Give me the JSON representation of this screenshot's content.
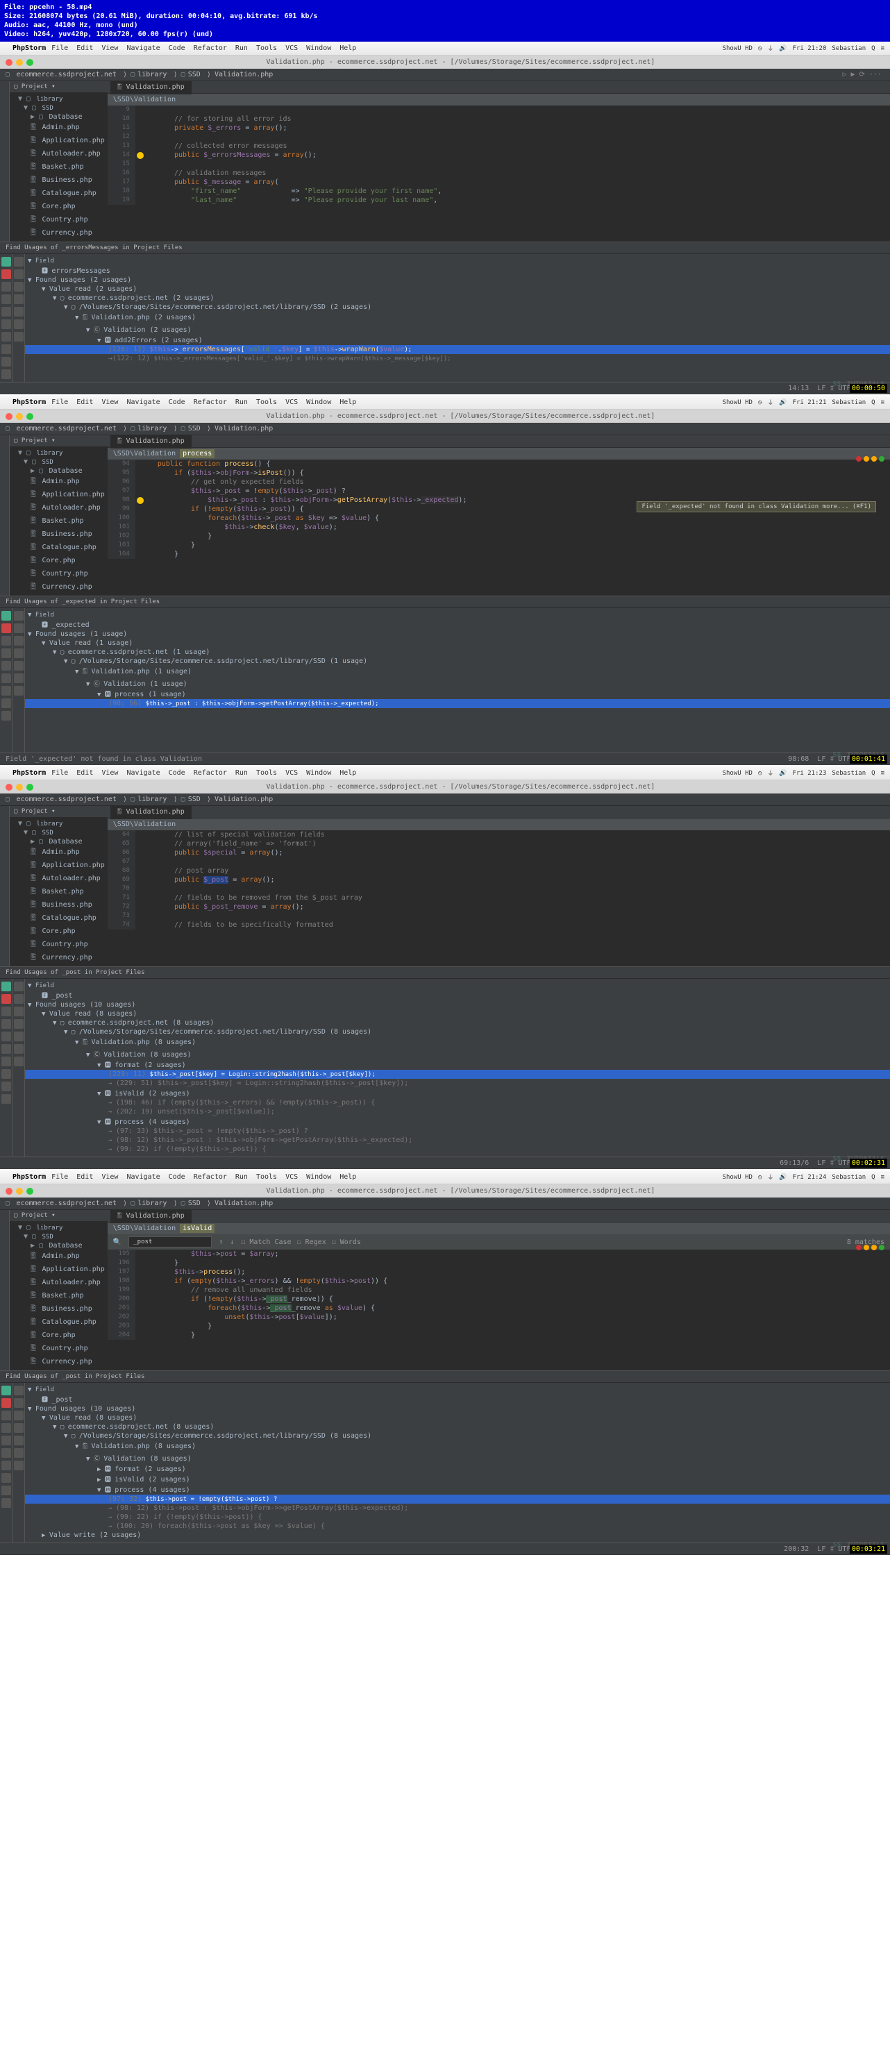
{
  "header": {
    "file": "File: ppcehn - 58.mp4",
    "size": "Size: 21608074 bytes (20.61 MiB), duration: 00:04:10, avg.bitrate: 691 kb/s",
    "audio": "Audio: aac, 44100 Hz, mono (und)",
    "video": "Video: h264, yuv420p, 1280x720, 60.00 fps(r) (und)"
  },
  "menus": [
    "File",
    "Edit",
    "View",
    "Navigate",
    "Code",
    "Refactor",
    "Run",
    "Tools",
    "VCS",
    "Window",
    "Help"
  ],
  "appname": "PhpStorm",
  "project_files": [
    "Database",
    "Admin.php",
    "Application.php",
    "Autoloader.php",
    "Basket.php",
    "Business.php",
    "Catalogue.php",
    "Core.php",
    "Country.php",
    "Currency.php"
  ],
  "breadcrumb": [
    "ecommerce.ssdproject.net",
    "library",
    "SSD",
    "Validation.php"
  ],
  "tab_name": "Validation.php",
  "shot1": {
    "time": "Fri 21:20",
    "user": "Sebastian",
    "title": "Validation.php - ecommerce.ssdproject.net - [/Volumes/Storage/Sites/ecommerce.ssdproject.net]",
    "namespace": "\\SSD\\Validation",
    "lines": [
      {
        "n": "9",
        "t": ""
      },
      {
        "n": "10",
        "t": "        // for storing all error ids"
      },
      {
        "n": "11",
        "t": "        private $_errors = array();"
      },
      {
        "n": "12",
        "t": ""
      },
      {
        "n": "13",
        "t": "        // collected error messages"
      },
      {
        "n": "14",
        "t": "        public $_errorsMessages = array();"
      },
      {
        "n": "15",
        "t": ""
      },
      {
        "n": "16",
        "t": "        // validation messages"
      },
      {
        "n": "17",
        "t": "        public $_message = array("
      },
      {
        "n": "18",
        "t": "            \"first_name\"            => \"Please provide your first name\","
      },
      {
        "n": "19",
        "t": "            \"last_name\"             => \"Please provide your last name\","
      }
    ],
    "find_title": "Find Usages of _errorsMessages in Project Files",
    "field": "errorsMessages",
    "found": "Found usages (2 usages)",
    "vr": "Value read (2 usages)",
    "proj": "ecommerce.ssdproject.net (2 usages)",
    "path": "/Volumes/Storage/Sites/ecommerce.ssdproject.net/library/SSD (2 usages)",
    "file": "Validation.php (2 usages)",
    "cls": "Validation (2 usages)",
    "method": "add2Errors (2 usages)",
    "u1": "(120: 12) $this->_errorsMessages['valid_'.$key] = $this->wrapWarn($value);",
    "u2": "(122: 12) $this->_errorsMessages['valid_'.$key] = $this->wrapWarn($this->_message[$key]);",
    "status_pos": "14:13",
    "status_lf": "LF ‡ UTF-8 ‡",
    "ts": "00:00:50"
  },
  "shot2": {
    "time": "Fri 21:21",
    "title": "Validation.php - ecommerce.ssdproject.net - [/Volumes/Storage/Sites/ecommerce.ssdproject.net]",
    "namespace": "\\SSD\\Validation",
    "method": "process",
    "lines": [
      {
        "n": "94",
        "t": "    public function process() {"
      },
      {
        "n": "95",
        "t": "        if ($this->objForm->isPost()) {"
      },
      {
        "n": "96",
        "t": "            // get only expected fields"
      },
      {
        "n": "97",
        "t": "            $this->_post = !empty($this->_post) ?"
      },
      {
        "n": "98",
        "t": "                $this->_post : $this->objForm->getPostArray($this->_expected);"
      },
      {
        "n": "99",
        "t": "            if (!empty($this->_post)) {"
      },
      {
        "n": "100",
        "t": "                foreach($this->_post as $key => $value) {"
      },
      {
        "n": "101",
        "t": "                    $this->check($key, $value);"
      },
      {
        "n": "102",
        "t": "                }"
      },
      {
        "n": "103",
        "t": "            }"
      },
      {
        "n": "104",
        "t": "        }"
      }
    ],
    "hint": "Field '_expected' not found in class Validation more... (⌘F1)",
    "find_title": "Find Usages of _expected in Project Files",
    "field": "_expected",
    "found": "Found usages (1 usage)",
    "vr": "Value read (1 usage)",
    "proj": "ecommerce.ssdproject.net (1 usage)",
    "path": "/Volumes/Storage/Sites/ecommerce.ssdproject.net/library/SSD (1 usage)",
    "file": "Validation.php (1 usage)",
    "cls": "Validation (1 usage)",
    "method_u": "process (1 usage)",
    "u1": "(98: 56) $this->_post : $this->objForm->getPostArray($this->_expected);",
    "status_msg": "Field '_expected' not found in class Validation",
    "status_pos": "98:68",
    "ts": "00:01:41"
  },
  "shot3": {
    "time": "Fri 21:23",
    "title": "Validation.php - ecommerce.ssdproject.net - [/Volumes/Storage/Sites/ecommerce.ssdproject.net]",
    "namespace": "\\SSD\\Validation",
    "lines": [
      {
        "n": "64",
        "t": "        // list of special validation fields"
      },
      {
        "n": "65",
        "t": "        // array('field_name' => 'format')"
      },
      {
        "n": "66",
        "t": "        public $special = array();"
      },
      {
        "n": "67",
        "t": ""
      },
      {
        "n": "68",
        "t": "        // post array"
      },
      {
        "n": "69",
        "t": "        public $_post = array();"
      },
      {
        "n": "70",
        "t": ""
      },
      {
        "n": "71",
        "t": "        // fields to be removed from the $_post array"
      },
      {
        "n": "72",
        "t": "        public $_post_remove = array();"
      },
      {
        "n": "73",
        "t": ""
      },
      {
        "n": "74",
        "t": "        // fields to be specifically formatted"
      }
    ],
    "find_title": "Find Usages of _post in Project Files",
    "field": "_post",
    "found": "Found usages (10 usages)",
    "vr": "Value read (8 usages)",
    "proj": "ecommerce.ssdproject.net (8 usages)",
    "path": "/Volumes/Storage/Sites/ecommerce.ssdproject.net/library/SSD (8 usages)",
    "file": "Validation.php (8 usages)",
    "cls": "Validation (8 usages)",
    "m1": "format (2 usages)",
    "m1u1": "(229: 11) $this->_post[$key] = Login::string2hash($this->_post[$key]);",
    "m1u2": "(229: 51) $this->_post[$key] = Login::string2hash($this->_post[$key]);",
    "m2": "isValid (2 usages)",
    "m2u1": "(198: 46) if (empty($this->_errors) && !empty($this->_post)) {",
    "m2u2": "(202: 19) unset($this->_post[$value]);",
    "m3": "process (4 usages)",
    "m3u1": "(97: 33) $this->_post = !empty($this->_post) ?",
    "m3u2": "(98: 12) $this->_post : $this->objForm->getPostArray($this->_expected);",
    "m3u3": "(99: 22) if (!empty($this->_post)) {",
    "status_pos": "69:13/6",
    "ts": "00:02:31"
  },
  "shot4": {
    "time": "Fri 21:24",
    "title": "Validation.php - ecommerce.ssdproject.net - [/Volumes/Storage/Sites/ecommerce.ssdproject.net]",
    "namespace": "\\SSD\\Validation",
    "method": "isValid",
    "search_term": "_post",
    "search_opts": [
      "Match Case",
      "Regex",
      "Words"
    ],
    "matches": "8 matches",
    "lines": [
      {
        "n": "195",
        "t": "            $this->post = $array;"
      },
      {
        "n": "196",
        "t": "        }"
      },
      {
        "n": "197",
        "t": "        $this->process();"
      },
      {
        "n": "198",
        "t": "        if (empty($this->_errors) && !empty($this->post)) {"
      },
      {
        "n": "199",
        "t": "            // remove all unwanted fields"
      },
      {
        "n": "200",
        "t": "            if (!empty($this->_post_remove)) {"
      },
      {
        "n": "201",
        "t": "                foreach($this->_post_remove as $value) {"
      },
      {
        "n": "202",
        "t": "                    unset($this->post[$value]);"
      },
      {
        "n": "203",
        "t": "                }"
      },
      {
        "n": "204",
        "t": "            }"
      }
    ],
    "find_title": "Find Usages of _post in Project Files",
    "field": "_post",
    "found": "Found usages (10 usages)",
    "vr": "Value read (8 usages)",
    "proj": "ecommerce.ssdproject.net (8 usages)",
    "path": "/Volumes/Storage/Sites/ecommerce.ssdproject.net/library/SSD (8 usages)",
    "file": "Validation.php (8 usages)",
    "cls": "Validation (8 usages)",
    "m1": "format (2 usages)",
    "m2": "isValid (2 usages)",
    "m3": "process (4 usages)",
    "m3u1": "(97: 32) $this->post = !empty($this->post) ?",
    "m3u2": "(98: 12) $this->post : $this->objForm->>getPostArray($this->expected);",
    "m3u3": "(99: 22) if (!empty($this->post)) {",
    "m3u4": "(100: 20) foreach($this->post as $key => $value) {",
    "vw": "Value write (2 usages)",
    "status_pos": "200:32",
    "ts": "00:03:21"
  },
  "watermark": "TUTORIALS"
}
